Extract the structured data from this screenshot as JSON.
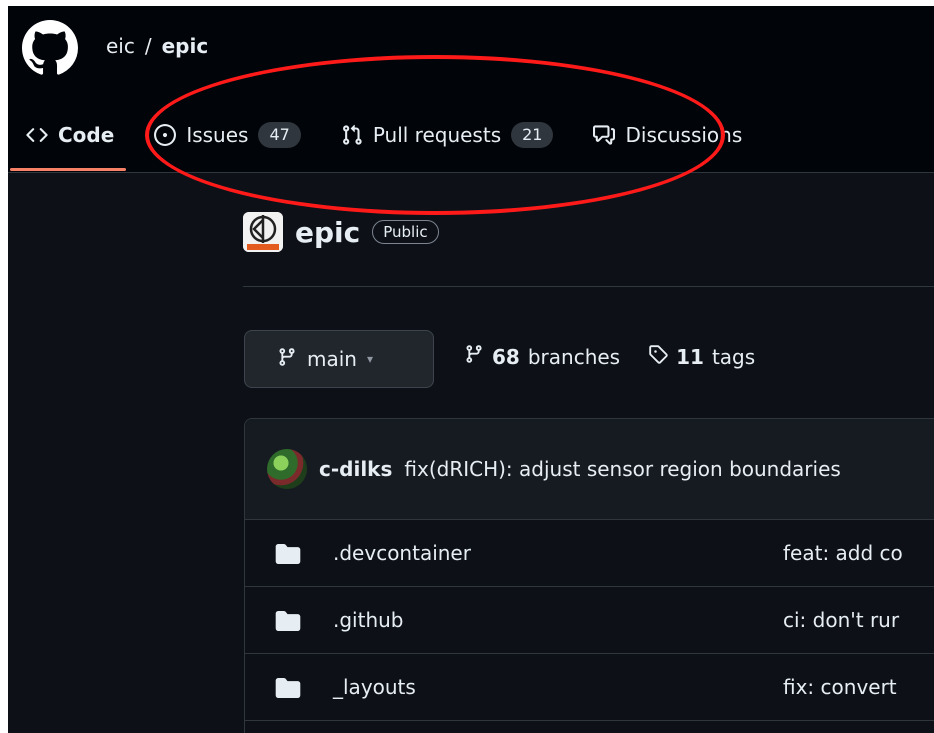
{
  "header": {
    "owner": "eic",
    "separator": "/",
    "repo": "epic"
  },
  "nav": {
    "code_label": "Code",
    "issues_label": "Issues",
    "issues_count": "47",
    "pulls_label": "Pull requests",
    "pulls_count": "21",
    "discussions_label": "Discussions"
  },
  "repo": {
    "name": "epic",
    "visibility": "Public"
  },
  "branch": {
    "current": "main",
    "branches_count": "68",
    "branches_label": "branches",
    "tags_count": "11",
    "tags_label": "tags"
  },
  "commit": {
    "author": "c-dilks",
    "message": "fix(dRICH): adjust sensor region boundaries"
  },
  "files": [
    {
      "name": ".devcontainer",
      "commit": "feat: add co"
    },
    {
      "name": ".github",
      "commit": "ci: don't rur"
    },
    {
      "name": "_layouts",
      "commit": "fix: convert"
    }
  ],
  "colors": {
    "background": "#0d1117",
    "header": "#010409",
    "accent_underline": "#f78166",
    "annotation_ring": "#ff1a1a"
  }
}
